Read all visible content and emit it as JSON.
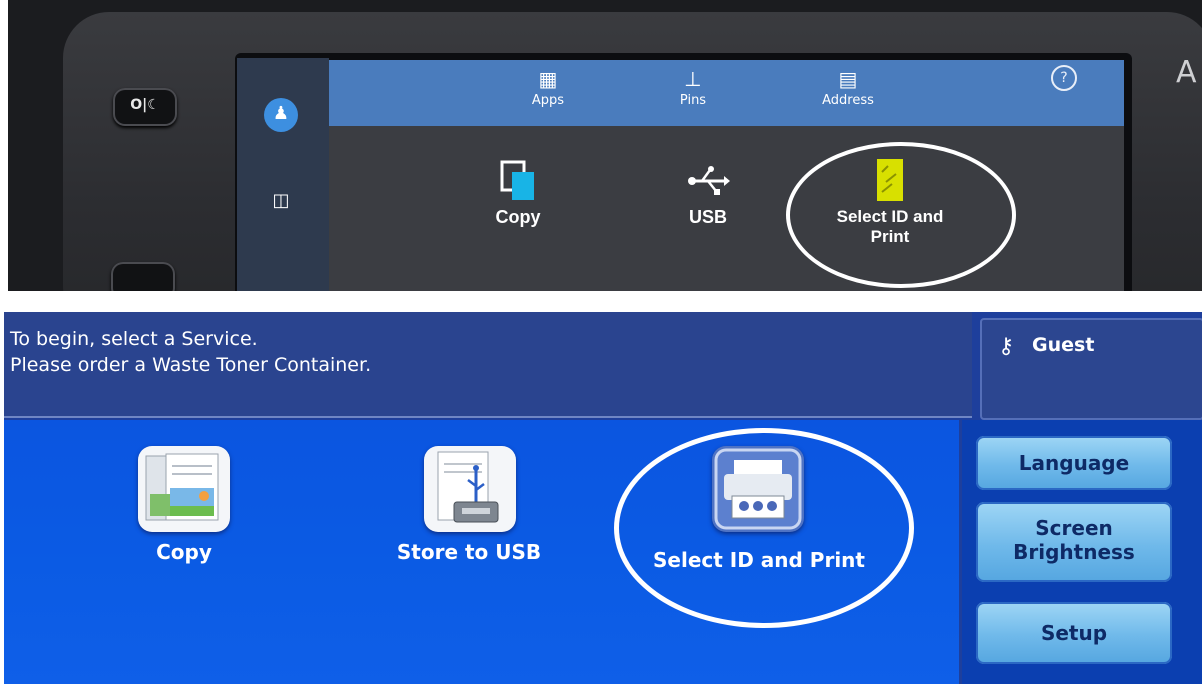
{
  "top_panel": {
    "brand_letter": "A",
    "power_button": "O|☾",
    "tabs": [
      {
        "icon": "apps-icon",
        "label": "Apps"
      },
      {
        "icon": "pins-icon",
        "label": "Pins"
      },
      {
        "icon": "address-book-icon",
        "label": "Address"
      }
    ],
    "apps": [
      {
        "label": "Copy",
        "icon": "copy-icon",
        "color": "#18b4e6"
      },
      {
        "label": "USB",
        "icon": "usb-icon",
        "color": "#ffffff"
      },
      {
        "label": "Select ID and",
        "label2": "Print",
        "icon": "select-id-print-icon",
        "color": "#d8e000"
      }
    ]
  },
  "bottom_panel": {
    "messages": [
      "To begin, select a Service.",
      "Please order a Waste Toner Container."
    ],
    "guest_label": "Guest",
    "services": [
      {
        "label": "Copy",
        "icon": "copy-icon"
      },
      {
        "label": "Store to USB",
        "icon": "store-to-usb-icon"
      },
      {
        "label": "Select ID and Print",
        "icon": "select-id-print-icon"
      }
    ],
    "side_buttons": [
      "Language",
      "Screen",
      "Brightness",
      "Setup"
    ]
  },
  "colors": {
    "top_tabbar": "#4a7cbd",
    "top_content": "#3b3d42",
    "bottom_main": "#0b55e0",
    "side_button": "#6fb9ea",
    "highlight_ellipse": "#ffffff"
  }
}
